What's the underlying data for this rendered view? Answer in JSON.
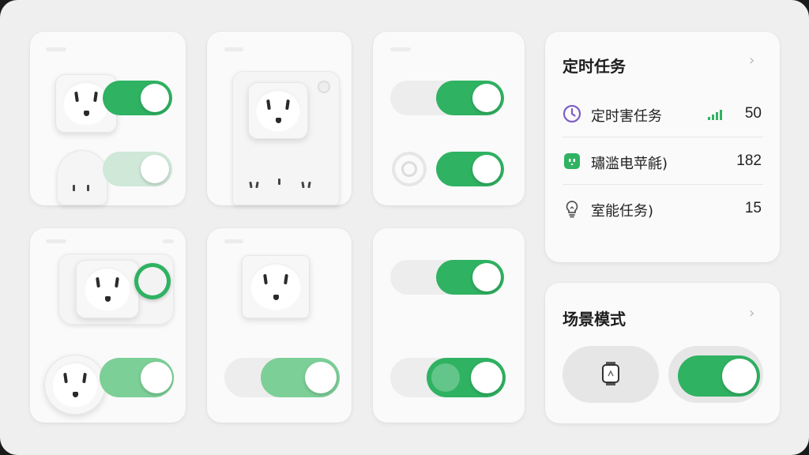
{
  "schedule_panel": {
    "title": "定时任务",
    "chevron": "›",
    "rows": [
      {
        "icon": "clock-icon",
        "label": "定时害任务",
        "value": "50",
        "has_signal": true
      },
      {
        "icon": "socket-face-icon",
        "label": "璛滥电苹毹)",
        "value": "182"
      },
      {
        "icon": "lightbulb-icon",
        "label": "室能任务)",
        "value": "15"
      }
    ]
  },
  "scene_panel": {
    "title": "场景模式",
    "chevron": "›",
    "watch_icon": "smartwatch-icon",
    "toggle_on": true
  },
  "colors": {
    "accent_green": "#2fb262",
    "clock_purple": "#7d5fc7",
    "socket_icon_green": "#2fb262"
  },
  "device_cards": [
    {
      "id": "card-1",
      "toggles": [
        "on",
        "soft"
      ]
    },
    {
      "id": "card-2",
      "toggles": []
    },
    {
      "id": "card-3",
      "toggles": [
        "on",
        "on"
      ]
    },
    {
      "id": "card-4",
      "toggles": [
        "on",
        "mid"
      ]
    },
    {
      "id": "card-5",
      "toggles": [
        "mid"
      ]
    },
    {
      "id": "card-6",
      "toggles": [
        "on",
        "on"
      ]
    }
  ]
}
